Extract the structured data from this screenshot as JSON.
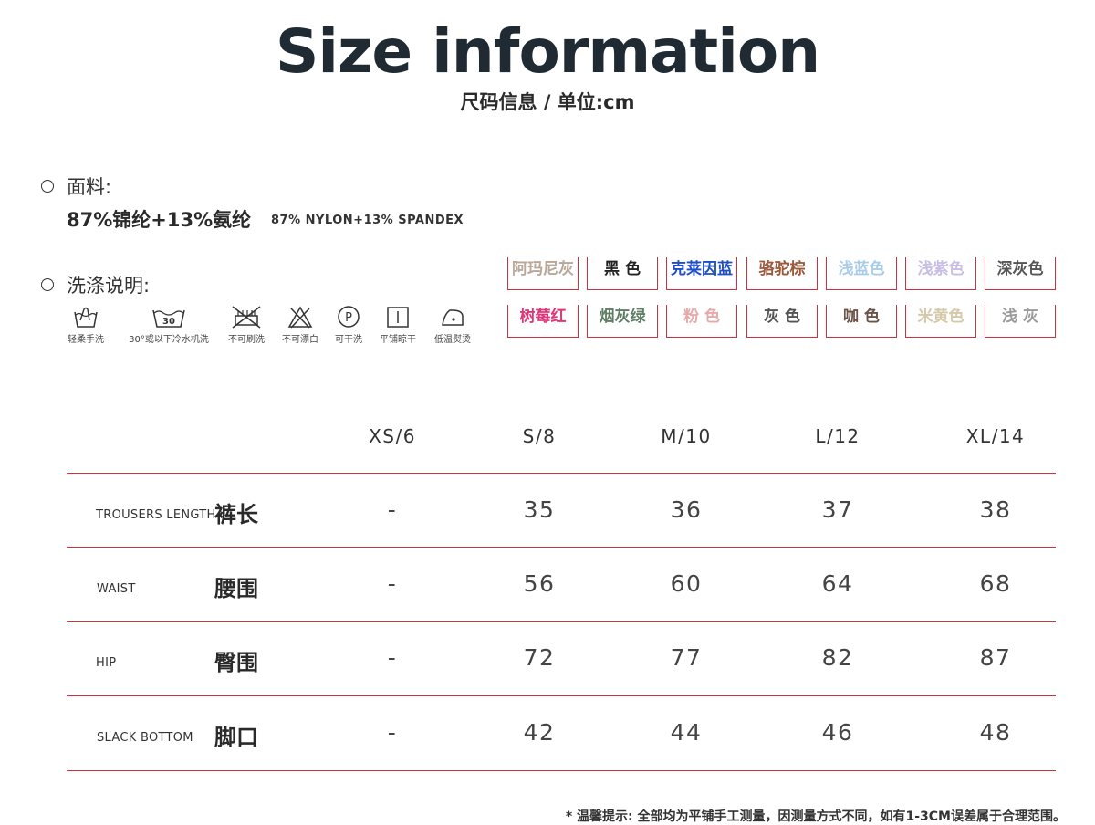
{
  "header": {
    "title": "Size information",
    "subtitle": "尺码信息 / 单位:cm"
  },
  "fabric": {
    "label": "面料:",
    "composition_cn": "87%锦纶+13%氨纶",
    "composition_en": "87% NYLON+13% SPANDEX"
  },
  "care": {
    "label": "洗涤说明:",
    "items": [
      {
        "icon": "hand-wash-icon",
        "label": "轻柔手洗"
      },
      {
        "icon": "machine-wash-30-icon",
        "label": "30°或以下冷水机洗",
        "number": "30"
      },
      {
        "icon": "no-brush-icon",
        "label": "不可刷洗"
      },
      {
        "icon": "no-bleach-icon",
        "label": "不可漂白"
      },
      {
        "icon": "dry-clean-icon",
        "label": "可干洗",
        "letter": "P"
      },
      {
        "icon": "line-dry-icon",
        "label": "平铺晾干"
      },
      {
        "icon": "low-iron-icon",
        "label": "低温熨烫"
      }
    ]
  },
  "colors": [
    [
      {
        "name": "阿玛尼灰",
        "color": "#b9a798"
      },
      {
        "name": "黑 色",
        "color": "#222222"
      },
      {
        "name": "克莱因蓝",
        "color": "#1f4fc7"
      },
      {
        "name": "骆驼棕",
        "color": "#9b5a3c"
      },
      {
        "name": "浅蓝色",
        "color": "#a9cde8"
      },
      {
        "name": "浅紫色",
        "color": "#c9bde6"
      },
      {
        "name": "深灰色",
        "color": "#555555"
      }
    ],
    [
      {
        "name": "树莓红",
        "color": "#e0367a"
      },
      {
        "name": "烟灰绿",
        "color": "#5f7f64"
      },
      {
        "name": "粉 色",
        "color": "#e8a9aa"
      },
      {
        "name": "灰 色",
        "color": "#555555"
      },
      {
        "name": "咖 色",
        "color": "#6a5448"
      },
      {
        "name": "米黄色",
        "color": "#d6c8aa"
      },
      {
        "name": "浅 灰",
        "color": "#9a9a9a"
      }
    ]
  ],
  "size_table": {
    "columns": [
      "XS/6",
      "S/8",
      "M/10",
      "L/12",
      "XL/14"
    ],
    "rows": [
      {
        "en": "TROUSERS LENGTH",
        "cn": "裤长",
        "values": [
          "-",
          "35",
          "36",
          "37",
          "38"
        ]
      },
      {
        "en": "WAIST",
        "cn": "腰围",
        "values": [
          "-",
          "56",
          "60",
          "64",
          "68"
        ]
      },
      {
        "en": "HIP",
        "cn": "臀围",
        "values": [
          "-",
          "72",
          "77",
          "82",
          "87"
        ]
      },
      {
        "en": "SLACK BOTTOM",
        "cn": "脚口",
        "values": [
          "-",
          "42",
          "44",
          "46",
          "48"
        ]
      }
    ]
  },
  "accent_color": "#c8333f",
  "footer": {
    "note": "* 温馨提示: 全部均为平铺手工测量，因测量方式不同，如有1-3CM误差属于合理范围。"
  }
}
